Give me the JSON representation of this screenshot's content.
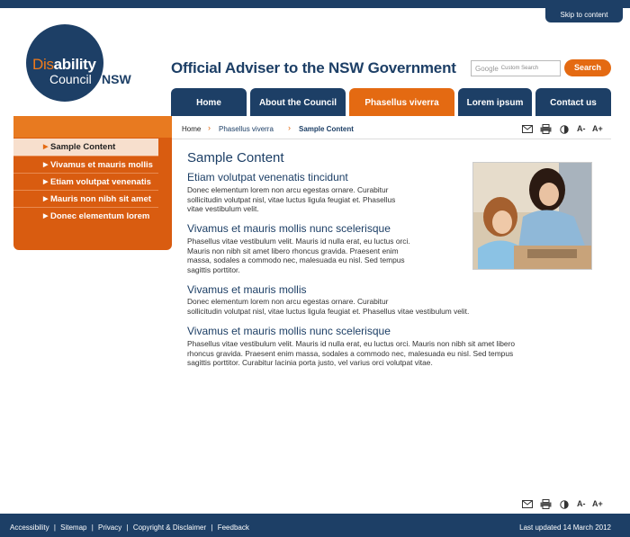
{
  "header": {
    "skip_link": "Skip to content",
    "logo": {
      "dis": "Dis",
      "ability": "ability",
      "council": "Council",
      "nsw": "NSW"
    },
    "site_title": "Official Adviser to the NSW Government",
    "search": {
      "google_label": "Google",
      "placeholder": "Custom Search",
      "button": "Search"
    }
  },
  "nav": {
    "items": [
      {
        "label": "Home"
      },
      {
        "label": "About the Council"
      },
      {
        "label": "Phasellus viverra",
        "active": true
      },
      {
        "label": "Lorem ipsum"
      },
      {
        "label": "Contact us"
      }
    ]
  },
  "sidebar": {
    "items": [
      {
        "label": "Sample Content",
        "active": true
      },
      {
        "label": "Vivamus et mauris mollis"
      },
      {
        "label": "Etiam volutpat venenatis"
      },
      {
        "label": "Mauris non nibh sit amet"
      },
      {
        "label": "Donec elementum lorem"
      }
    ]
  },
  "breadcrumb": {
    "home": "Home",
    "level2": "Phasellus viverra",
    "current": "Sample Content"
  },
  "tools": {
    "decrease_text": "A-",
    "increase_text": "A+"
  },
  "main": {
    "heading": "Sample Content",
    "sections": [
      {
        "title": "Etiam volutpat venenatis tincidunt",
        "body_lines": [
          "Donec elementum lorem non arcu egestas ornare. Curabitur",
          "sollicitudin volutpat nisl, vitae luctus ligula feugiat et. Phasellus",
          "vitae vestibulum velit."
        ]
      },
      {
        "title": "Vivamus et mauris mollis nunc scelerisque",
        "body_lines": [
          "Phasellus vitae vestibulum velit. Mauris id nulla erat, eu luctus orci.",
          "Mauris non nibh sit amet libero rhoncus gravida. Praesent enim",
          "massa, sodales a commodo nec, malesuada eu nisl. Sed tempus",
          "sagittis porttitor."
        ]
      },
      {
        "title": "Vivamus et mauris mollis",
        "body_lines": [
          "Donec elementum lorem non arcu egestas ornare. Curabitur",
          "sollicitudin volutpat nisl, vitae luctus ligula feugiat et. Phasellus vitae vestibulum velit."
        ]
      },
      {
        "title": "Vivamus et mauris mollis nunc scelerisque",
        "body_lines": [
          "Phasellus vitae vestibulum velit. Mauris id nulla erat, eu luctus orci. Mauris non nibh sit amet libero",
          "rhoncus gravida. Praesent enim massa, sodales a commodo nec, malesuada eu nisl. Sed tempus",
          "sagittis porttitor. Curabitur lacinia porta justo, vel varius orci volutpat vitae."
        ]
      }
    ]
  },
  "footer": {
    "links": [
      "Accessibility",
      "Sitemap",
      "Privacy",
      "Copyright & Disclaimer",
      "Feedback"
    ],
    "separator": "|",
    "last_updated": "Last updated 14 March 2012"
  },
  "colors": {
    "navy": "#1d3f66",
    "orange": "#e46a12",
    "light_orange": "#f7dfcd"
  },
  "icons": [
    "email-icon",
    "print-icon",
    "contrast-icon"
  ]
}
